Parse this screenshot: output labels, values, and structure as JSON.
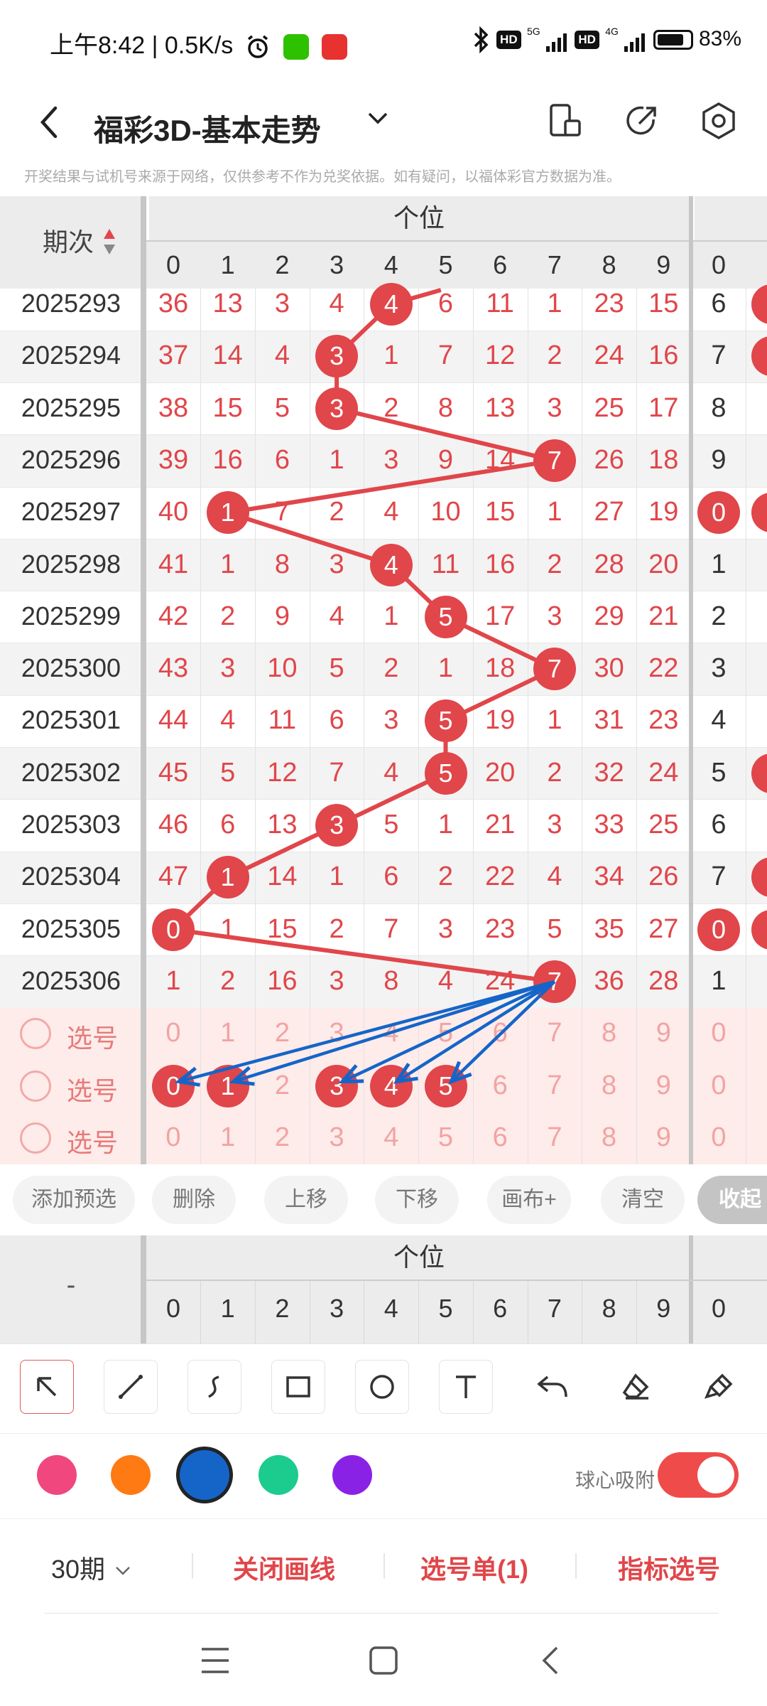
{
  "status_bar": {
    "time": "上午8:42",
    "speed": "0.5K/s",
    "hd_label": "HD",
    "net1": "5G",
    "net2": "4G",
    "battery_text": "83%",
    "battery_level": 0.83
  },
  "header": {
    "title": "福彩3D-基本走势"
  },
  "disclaimer": "开奖结果与试机号来源于网络，仅供参考不作为兑奖依据。如有疑问，以福体彩官方数据为准。",
  "grid": {
    "period_header": "期次",
    "group_label": "个位",
    "digits": [
      "0",
      "1",
      "2",
      "3",
      "4",
      "5",
      "6",
      "7",
      "8",
      "9"
    ],
    "next_group_first_digit": "0",
    "rows": [
      {
        "period": "2025293",
        "values": [
          "36",
          "13",
          "3",
          "4",
          "4",
          "6",
          "11",
          "1",
          "23",
          "15"
        ],
        "hit": 4,
        "extra": "6"
      },
      {
        "period": "2025294",
        "values": [
          "37",
          "14",
          "4",
          "3",
          "1",
          "7",
          "12",
          "2",
          "24",
          "16"
        ],
        "hit": 3,
        "extra": "7"
      },
      {
        "period": "2025295",
        "values": [
          "38",
          "15",
          "5",
          "3",
          "2",
          "8",
          "13",
          "3",
          "25",
          "17"
        ],
        "hit": 3,
        "extra": "8"
      },
      {
        "period": "2025296",
        "values": [
          "39",
          "16",
          "6",
          "1",
          "3",
          "9",
          "14",
          "7",
          "26",
          "18"
        ],
        "hit": 7,
        "extra": "9"
      },
      {
        "period": "2025297",
        "values": [
          "40",
          "1",
          "7",
          "2",
          "4",
          "10",
          "15",
          "1",
          "27",
          "19"
        ],
        "hit": 1,
        "extra": "0"
      },
      {
        "period": "2025298",
        "values": [
          "41",
          "1",
          "8",
          "3",
          "4",
          "11",
          "16",
          "2",
          "28",
          "20"
        ],
        "hit": 4,
        "extra": "1"
      },
      {
        "period": "2025299",
        "values": [
          "42",
          "2",
          "9",
          "4",
          "1",
          "5",
          "17",
          "3",
          "29",
          "21"
        ],
        "hit": 5,
        "extra": "2"
      },
      {
        "period": "2025300",
        "values": [
          "43",
          "3",
          "10",
          "5",
          "2",
          "1",
          "18",
          "7",
          "30",
          "22"
        ],
        "hit": 7,
        "extra": "3"
      },
      {
        "period": "2025301",
        "values": [
          "44",
          "4",
          "11",
          "6",
          "3",
          "5",
          "19",
          "1",
          "31",
          "23"
        ],
        "hit": 5,
        "extra": "4"
      },
      {
        "period": "2025302",
        "values": [
          "45",
          "5",
          "12",
          "7",
          "4",
          "5",
          "20",
          "2",
          "32",
          "24"
        ],
        "hit": 5,
        "extra": "5"
      },
      {
        "period": "2025303",
        "values": [
          "46",
          "6",
          "13",
          "3",
          "5",
          "1",
          "21",
          "3",
          "33",
          "25"
        ],
        "hit": 3,
        "extra": "6"
      },
      {
        "period": "2025304",
        "values": [
          "47",
          "1",
          "14",
          "1",
          "6",
          "2",
          "22",
          "4",
          "34",
          "26"
        ],
        "hit": 1,
        "extra": "7"
      },
      {
        "period": "2025305",
        "values": [
          "0",
          "1",
          "15",
          "2",
          "7",
          "3",
          "23",
          "5",
          "35",
          "27"
        ],
        "hit": 0,
        "extra": "0"
      },
      {
        "period": "2025306",
        "values": [
          "1",
          "2",
          "16",
          "3",
          "8",
          "4",
          "24",
          "7",
          "36",
          "28"
        ],
        "hit": 7,
        "extra": "1"
      }
    ],
    "extra_hit_rows": [
      4,
      12
    ],
    "selection_rows": [
      {
        "label": "选号",
        "selected": []
      },
      {
        "label": "选号",
        "selected": [
          0,
          1,
          3,
          4,
          5
        ]
      },
      {
        "label": "选号",
        "selected": []
      }
    ]
  },
  "actions": [
    "添加预选",
    "删除",
    "上移",
    "下移",
    "画布+",
    "清空",
    "收起"
  ],
  "lower_table": {
    "period_header": "-",
    "group_label": "个位"
  },
  "draw_tools": [
    "pointer-icon",
    "line-icon",
    "curve-icon",
    "rectangle-icon",
    "circle-icon",
    "text-icon",
    "undo-icon",
    "eraser-icon",
    "clear-brush-icon"
  ],
  "colors": {
    "accent": "#e0464a",
    "swatches": [
      "#f0477f",
      "#ff7a12",
      "#1565c8",
      "#1bcc8e",
      "#8a22e6"
    ],
    "selected_swatch": "#1565c8"
  },
  "snap": {
    "label": "球心吸附",
    "on": true
  },
  "bottom_menu": {
    "periods": "30期",
    "close_lines": "关闭画线",
    "selection_list": "选号单(1)",
    "indicator": "指标选号"
  }
}
